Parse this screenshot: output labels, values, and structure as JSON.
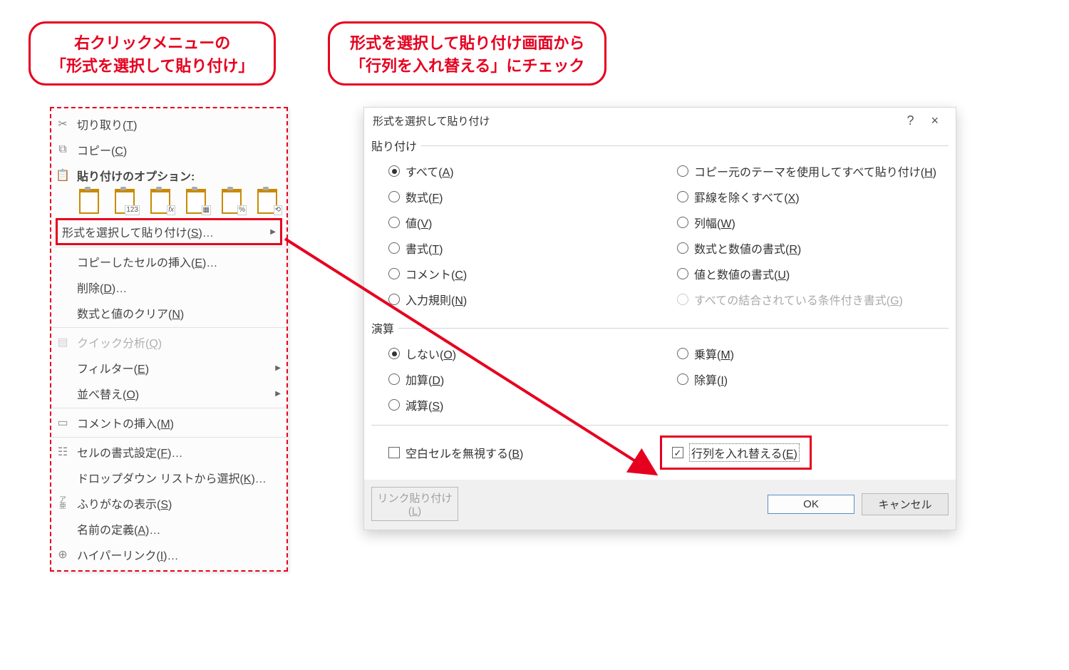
{
  "annotations": {
    "left_line1": "右クリックメニューの",
    "left_line2": "「形式を選択して貼り付け」",
    "right_line1": "形式を選択して貼り付け画面から",
    "right_line2": "「行列を入れ替える」にチェック"
  },
  "context_menu": {
    "cut": "切り取り(T)",
    "copy": "コピー(C)",
    "paste_options_header": "貼り付けのオプション:",
    "paste_icons": [
      "paste-basic",
      "paste-values",
      "paste-fx",
      "paste-format",
      "paste-percent",
      "paste-link"
    ],
    "paste_special": "形式を選択して貼り付け(S)…",
    "insert_copied": "コピーしたセルの挿入(E)…",
    "delete": "削除(D)…",
    "clear": "数式と値のクリア(N)",
    "quick_analysis": "クイック分析(Q)",
    "filter": "フィルター(E)",
    "sort": "並べ替え(O)",
    "insert_comment": "コメントの挿入(M)",
    "format_cells": "セルの書式設定(F)…",
    "dropdown_list": "ドロップダウン リストから選択(K)…",
    "furigana": "ふりがなの表示(S)",
    "define_name": "名前の定義(A)…",
    "hyperlink": "ハイパーリンク(I)…"
  },
  "dialog": {
    "title": "形式を選択して貼り付け",
    "help": "?",
    "close": "×",
    "group_paste": "貼り付け",
    "group_operation": "演算",
    "paste_options_left": [
      "すべて(A)",
      "数式(F)",
      "値(V)",
      "書式(T)",
      "コメント(C)",
      "入力規則(N)"
    ],
    "paste_options_right": [
      "コピー元のテーマを使用してすべて貼り付け(H)",
      "罫線を除くすべて(X)",
      "列幅(W)",
      "数式と数値の書式(R)",
      "値と数値の書式(U)",
      "すべての結合されている条件付き書式(G)"
    ],
    "operation_left": [
      "しない(O)",
      "加算(D)",
      "減算(S)"
    ],
    "operation_right": [
      "乗算(M)",
      "除算(I)"
    ],
    "skip_blanks": "空白セルを無視する(B)",
    "transpose": "行列を入れ替える(E)",
    "link_paste": "リンク貼り付け(L)",
    "ok": "OK",
    "cancel": "キャンセル"
  },
  "selections": {
    "paste_selected": "すべて(A)",
    "paste_disabled": "すべての結合されている条件付き書式(G)",
    "operation_selected": "しない(O)",
    "skip_blanks_checked": false,
    "transpose_checked": true
  }
}
